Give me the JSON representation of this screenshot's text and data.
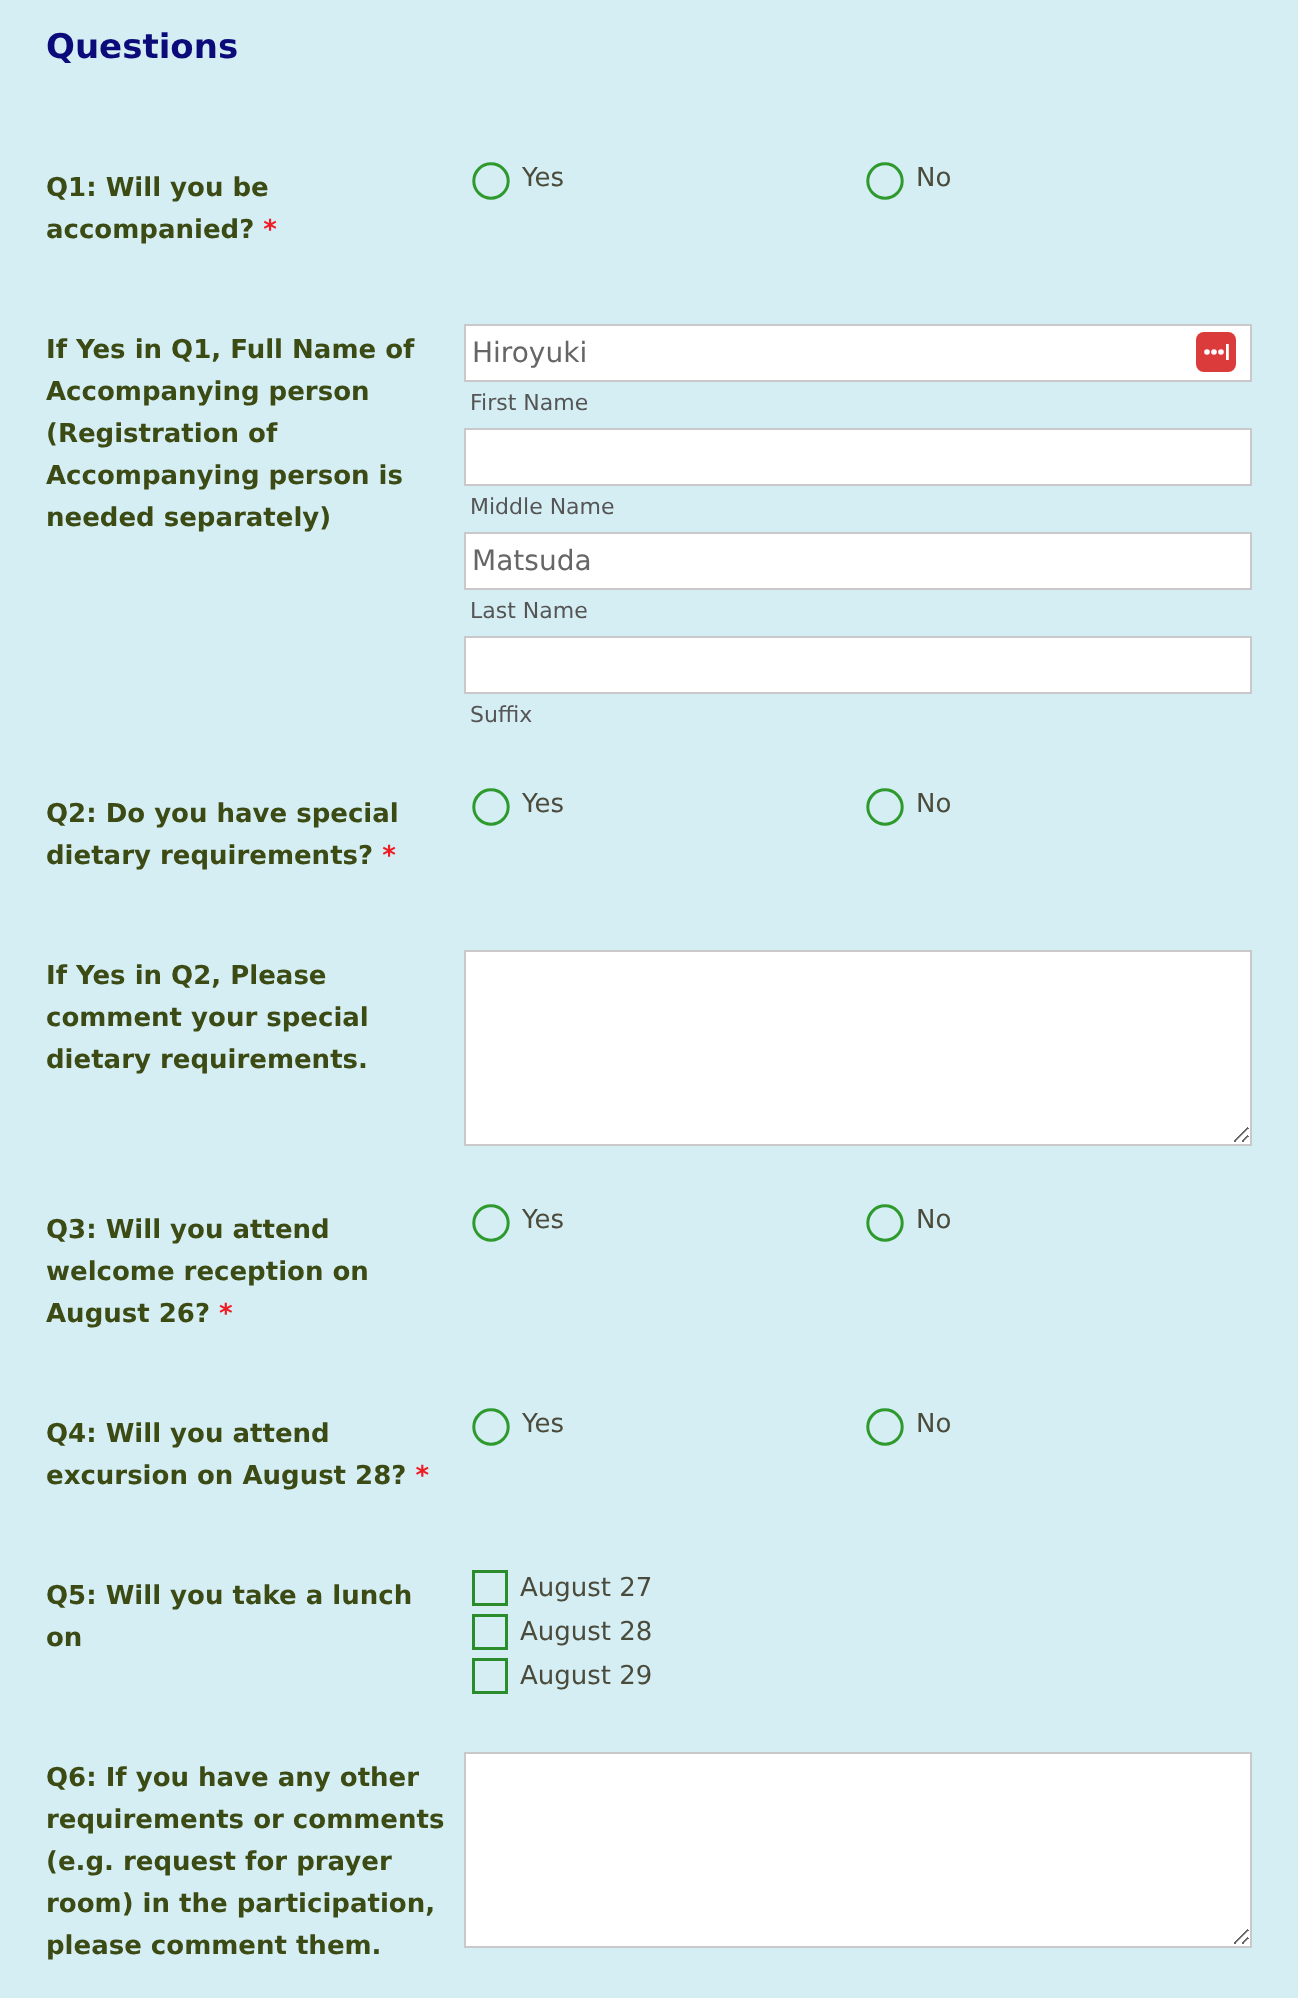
{
  "title": "Questions",
  "questions": [
    {
      "kind": "radio",
      "label": "Q1: Will you be accompanied?",
      "required_mark": "*",
      "options": [
        {
          "label": "Yes",
          "selected": false
        },
        {
          "label": "No",
          "selected": false
        }
      ]
    },
    {
      "kind": "name",
      "label": "If Yes in Q1, Full Name of Accompanying person (Registration of Accompanying person is needed separately)",
      "fields": [
        {
          "value": "Hiroyuki",
          "caption": "First Name",
          "autofill_icon": true
        },
        {
          "caption": "Middle Name",
          "autofill_icon": false
        },
        {
          "value": "Matsuda",
          "caption": "Last Name",
          "autofill_icon": false
        },
        {
          "caption": "Suffix",
          "autofill_icon": false
        }
      ]
    },
    {
      "kind": "radio",
      "label": "Q2: Do you have special dietary requirements?",
      "required_mark": "*",
      "options": [
        {
          "label": "Yes",
          "selected": false
        },
        {
          "label": "No",
          "selected": false
        }
      ]
    },
    {
      "kind": "textarea",
      "label": "If Yes in Q2, Please comment your special dietary requirements."
    },
    {
      "kind": "radio",
      "label": "Q3: Will you attend welcome reception on August 26?",
      "required_mark": "*",
      "options": [
        {
          "label": "Yes",
          "selected": false
        },
        {
          "label": "No",
          "selected": false
        }
      ]
    },
    {
      "kind": "radio",
      "label": "Q4: Will you attend excursion on August 28?",
      "required_mark": "*",
      "options": [
        {
          "label": "Yes",
          "selected": false
        },
        {
          "label": "No",
          "selected": false
        }
      ]
    },
    {
      "kind": "checkbox",
      "label": "Q5: Will you take a lunch on",
      "options": [
        {
          "label": "August 27",
          "checked": false
        },
        {
          "label": "August 28",
          "checked": false
        },
        {
          "label": "August 29",
          "checked": false
        }
      ]
    },
    {
      "kind": "textarea",
      "label": "Q6: If you have any other requirements or comments (e.g. request for prayer room) in the participation, please comment them."
    }
  ]
}
